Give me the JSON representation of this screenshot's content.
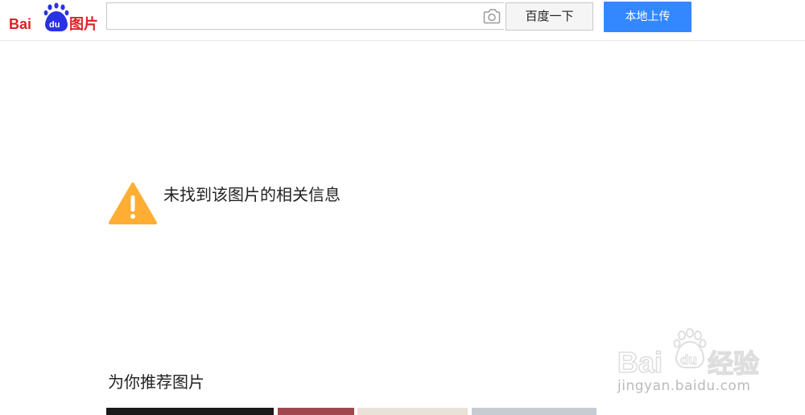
{
  "header": {
    "logo": {
      "text_bai": "Bai",
      "text_du": "du",
      "text_tupian": "图片"
    },
    "search": {
      "value": "",
      "placeholder": ""
    },
    "search_button_label": "百度一下",
    "upload_button_label": "本地上传"
  },
  "main": {
    "notfound_message": "未找到该图片的相关信息",
    "recommend_title": "为你推荐图片",
    "thumbnails": [
      {
        "color": "#1a1a1a"
      },
      {
        "color": "#a0484e"
      },
      {
        "color": "#e8e2d8"
      },
      {
        "color": "#c7ccd2"
      }
    ]
  },
  "watermark": {
    "brand_bai": "Bai",
    "brand_du": "du",
    "brand_suffix": "经验",
    "url": "jingyan.baidu.com"
  },
  "colors": {
    "brand_red": "#de1f26",
    "brand_blue": "#2932e1",
    "upload_blue": "#3388ff",
    "warning_orange": "#ffad33"
  }
}
